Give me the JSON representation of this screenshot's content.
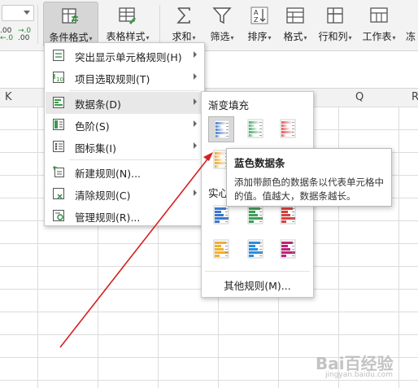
{
  "ribbon": {
    "decimal": {
      "inc": ".00",
      "inc_sub": "←.0",
      "dec": "→.0",
      "dec_sub": ".00"
    },
    "buttons": [
      {
        "id": "conditional-format",
        "label": "条件格式",
        "icon": "conditional-format-icon"
      },
      {
        "id": "table-style",
        "label": "表格样式",
        "icon": "table-style-icon"
      },
      {
        "id": "sum",
        "label": "求和",
        "icon": "sigma-icon"
      },
      {
        "id": "filter",
        "label": "筛选",
        "icon": "filter-icon"
      },
      {
        "id": "sort",
        "label": "排序",
        "icon": "sort-icon"
      },
      {
        "id": "format",
        "label": "格式",
        "icon": "format-icon"
      },
      {
        "id": "rows-cols",
        "label": "行和列",
        "icon": "rows-cols-icon"
      },
      {
        "id": "worksheet",
        "label": "工作表",
        "icon": "worksheet-icon"
      },
      {
        "id": "freeze",
        "label": "冻",
        "icon": "freeze-icon"
      }
    ]
  },
  "columns": {
    "k": "K",
    "q": "Q",
    "r": "R"
  },
  "menu": {
    "items": [
      {
        "label": "突出显示单元格规则(H)",
        "icon": "highlight-rules-icon",
        "submenu": true
      },
      {
        "label": "项目选取规则(T)",
        "icon": "top-bottom-rules-icon",
        "submenu": true
      },
      {
        "label": "数据条(D)",
        "icon": "data-bars-icon",
        "submenu": true,
        "highlighted": true
      },
      {
        "label": "色阶(S)",
        "icon": "color-scales-icon",
        "submenu": true
      },
      {
        "label": "图标集(I)",
        "icon": "icon-sets-icon",
        "submenu": true
      },
      {
        "label": "新建规则(N)...",
        "icon": "new-rule-icon",
        "submenu": false
      },
      {
        "label": "清除规则(C)",
        "icon": "clear-rules-icon",
        "submenu": true
      },
      {
        "label": "管理规则(R)...",
        "icon": "manage-rules-icon",
        "submenu": false
      }
    ]
  },
  "submenu": {
    "gradient_title": "渐变填充",
    "solid_title": "实心填充",
    "gradient_colors": [
      "#4a7fd0",
      "#4caf6a",
      "#e05a5a",
      "#f0a830"
    ],
    "solid_colors": [
      "#3a78d0",
      "#3fa05a",
      "#d9413f",
      "#f0b030",
      "#2a8ee0",
      "#c0227a"
    ],
    "other_rules": "其他规则(M)..."
  },
  "tooltip": {
    "title": "蓝色数据条",
    "body": "添加带颜色的数据条以代表单元格中的值。值越大，数据条越长。"
  },
  "watermark": {
    "text": "Bai百经验",
    "sub": "jingyan.baidu.com"
  },
  "colors": {
    "arrow": "#d62020",
    "menu_highlight": "#e8e8e8",
    "ribbon_bg": "#f3f3f3"
  }
}
